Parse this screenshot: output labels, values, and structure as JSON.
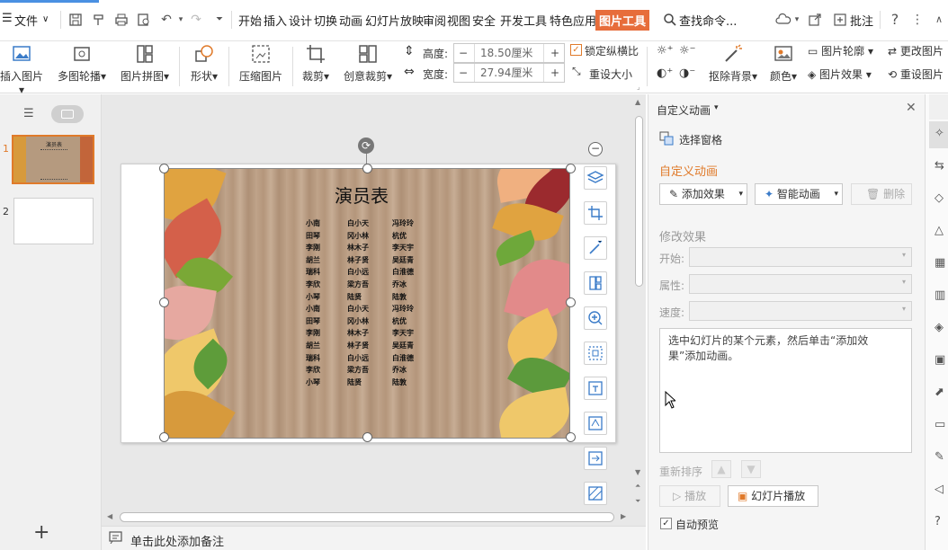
{
  "menubar": {
    "file_label": "文件",
    "tabs": [
      "开始",
      "插入",
      "设计",
      "切换",
      "动画",
      "幻灯片放映",
      "审阅",
      "视图",
      "安全",
      "开发工具",
      "特色应用",
      "图片工具"
    ],
    "active_tab": "图片工具",
    "search_label": "查找命令...",
    "comment_label": "批注"
  },
  "ribbon": {
    "insert_picture": "插入图片",
    "multi_carousel": "多图轮播",
    "picture_collage": "图片拼图",
    "shape": "形状",
    "compress": "压缩图片",
    "crop": "裁剪",
    "creative_crop": "创意裁剪",
    "height_label": "高度:",
    "height_value": "18.50厘米",
    "width_label": "宽度:",
    "width_value": "27.94厘米",
    "lock_ratio": "锁定纵横比",
    "resize": "重设大小",
    "remove_bg": "抠除背景",
    "color": "颜色",
    "pic_outline": "图片轮廓",
    "pic_effect": "图片效果",
    "change_pic": "更改图片",
    "reset_pic": "重设图片",
    "minus": "−",
    "plus": "+"
  },
  "slides": {
    "numbers": [
      "1",
      "2"
    ],
    "thumb_title": "演员表",
    "add": "+"
  },
  "slide": {
    "title": "演员表",
    "col1": [
      "小南",
      "田琴",
      "李刚",
      "胡兰",
      "瑞科",
      "李欣",
      "小琴",
      "小南",
      "田琴",
      "李刚",
      "胡兰",
      "瑞科",
      "李欣",
      "小琴"
    ],
    "col2": [
      "白小天",
      "冈小林",
      "林木子",
      "林子贤",
      "白小远",
      "梁方吾",
      "陆贤",
      "白小天",
      "冈小林",
      "林木子",
      "林子贤",
      "白小远",
      "梁方吾",
      "陆贤"
    ],
    "col3": [
      "冯玲玲",
      "杭优",
      "李天宇",
      "吴廷青",
      "白淮德",
      "乔冰",
      "陆敦",
      "冯玲玲",
      "杭优",
      "李天宇",
      "吴廷青",
      "白淮德",
      "乔冰",
      "陆敦"
    ]
  },
  "notes": {
    "placeholder": "单击此处添加备注"
  },
  "pane": {
    "header": "自定义动画",
    "selection_pane": "选择窗格",
    "section_title": "自定义动画",
    "add_effect": "添加效果",
    "smart_anim": "智能动画",
    "delete": "删除",
    "modify_title": "修改效果",
    "start_label": "开始:",
    "property_label": "属性:",
    "speed_label": "速度:",
    "hint": "选中幻灯片的某个元素，然后单击“添加效果”添加动画。",
    "reorder": "重新排序",
    "play": "播放",
    "slideshow": "幻灯片播放",
    "auto_preview": "自动预览"
  },
  "colors": {
    "accent": "#e76d3b",
    "pane_title": "#e07a2a"
  }
}
